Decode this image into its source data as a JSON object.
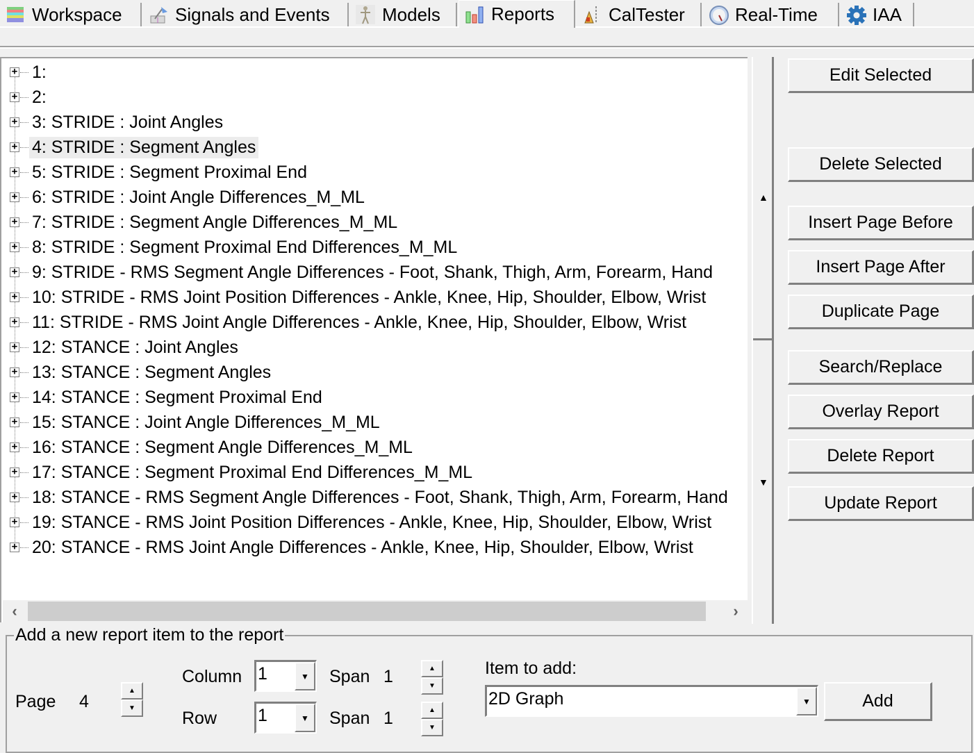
{
  "tabs": [
    {
      "label": "Workspace",
      "icon": "workspace-icon",
      "active": false
    },
    {
      "label": "Signals and Events",
      "icon": "signals-events-icon",
      "active": false
    },
    {
      "label": "Models",
      "icon": "skeleton-model-icon",
      "active": false
    },
    {
      "label": "Reports",
      "icon": "bar-chart-icon",
      "active": true
    },
    {
      "label": "CalTester",
      "icon": "caltester-icon",
      "active": false
    },
    {
      "label": "Real-Time",
      "icon": "real-time-icon",
      "active": false
    },
    {
      "label": "IAA",
      "icon": "gear-icon",
      "active": false
    }
  ],
  "tree": {
    "selected_index": 3,
    "items": [
      {
        "label": "1:"
      },
      {
        "label": "2:"
      },
      {
        "label": "3: STRIDE : Joint Angles"
      },
      {
        "label": "4: STRIDE : Segment Angles"
      },
      {
        "label": "5: STRIDE : Segment Proximal End"
      },
      {
        "label": "6: STRIDE : Joint Angle Differences_M_ML"
      },
      {
        "label": "7: STRIDE : Segment Angle Differences_M_ML"
      },
      {
        "label": "8: STRIDE : Segment Proximal End Differences_M_ML"
      },
      {
        "label": "9: STRIDE - RMS Segment Angle Differences - Foot, Shank, Thigh, Arm, Forearm, Hand"
      },
      {
        "label": "10: STRIDE - RMS Joint Position Differences - Ankle, Knee, Hip, Shoulder, Elbow, Wrist"
      },
      {
        "label": "11: STRIDE - RMS Joint Angle Differences - Ankle, Knee, Hip, Shoulder, Elbow, Wrist"
      },
      {
        "label": "12: STANCE : Joint Angles"
      },
      {
        "label": "13: STANCE : Segment Angles"
      },
      {
        "label": "14: STANCE : Segment Proximal End"
      },
      {
        "label": "15: STANCE : Joint Angle Differences_M_ML"
      },
      {
        "label": "16: STANCE : Segment Angle Differences_M_ML"
      },
      {
        "label": "17: STANCE : Segment Proximal End Differences_M_ML"
      },
      {
        "label": "18: STANCE - RMS Segment Angle Differences - Foot, Shank, Thigh, Arm, Forearm, Hand"
      },
      {
        "label": "19: STANCE - RMS Joint Position Differences - Ankle, Knee, Hip, Shoulder, Elbow, Wrist"
      },
      {
        "label": "20: STANCE - RMS Joint Angle Differences - Ankle, Knee, Hip, Shoulder, Elbow, Wrist"
      }
    ],
    "expander_glyph": "+",
    "scroll_left_glyph": "‹",
    "scroll_right_glyph": "›"
  },
  "split": {
    "up_glyph": "▲",
    "down_glyph": "▼"
  },
  "buttons": {
    "edit_selected": "Edit Selected",
    "delete_selected": "Delete Selected",
    "insert_page_before": "Insert Page Before",
    "insert_page_after": "Insert Page After",
    "duplicate_page": "Duplicate Page",
    "search_replace": "Search/Replace",
    "overlay_report": "Overlay Report",
    "delete_report": "Delete Report",
    "update_report": "Update Report"
  },
  "add_item": {
    "group_title": "Add a new report item to the report",
    "page_label": "Page",
    "page_value": "4",
    "column_label": "Column",
    "column_value": "1",
    "column_span_label": "Span",
    "column_span_value": "1",
    "row_label": "Row",
    "row_value": "1",
    "row_span_label": "Span",
    "row_span_value": "1",
    "item_label": "Item to add:",
    "item_value": "2D Graph",
    "add_button": "Add",
    "spin_up_glyph": "▲",
    "spin_down_glyph": "▼",
    "dropdown_glyph": "▼"
  }
}
